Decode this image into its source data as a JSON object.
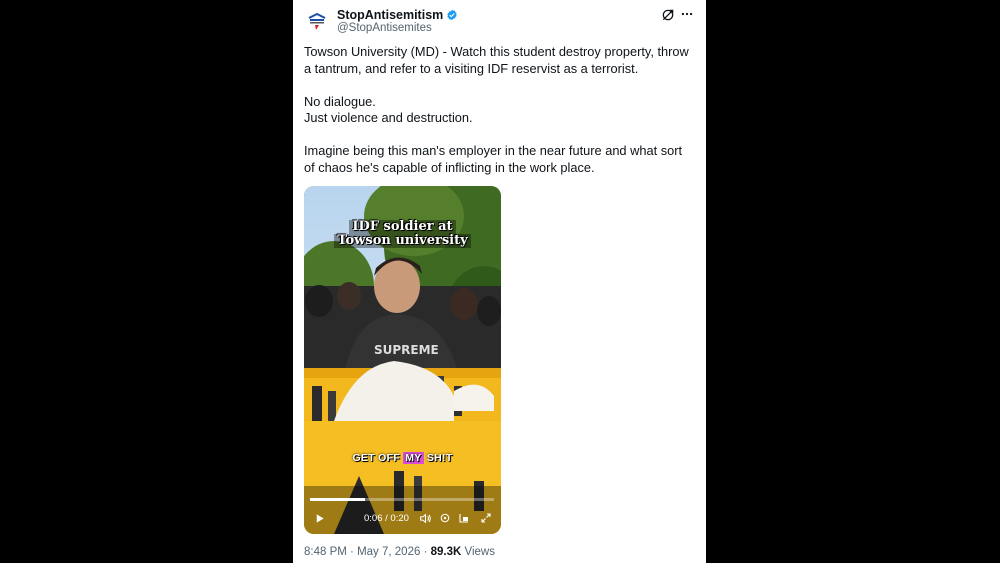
{
  "account": {
    "display_name": "StopAntisemitism",
    "handle": "@StopAntisemites",
    "verified": true
  },
  "tweet": {
    "paragraphs": [
      "Towson University (MD) - Watch this student destroy property, throw a tantrum, and refer to a visiting IDF reservist as a terrorist.",
      "No dialogue.",
      "Just violence and destruction.",
      "Imagine being this man's employer in the near future and what sort of chaos he's capable of inflicting in the work place."
    ]
  },
  "video": {
    "overlay_title_line1": "IDF soldier at",
    "overlay_title_line2": "Towson university",
    "caption_pre": "GET OFF ",
    "caption_highlight": "MY",
    "caption_post": " SH!T",
    "current_time": "0:06",
    "duration": "0:20",
    "time_separator": "/",
    "progress_fraction": 0.3
  },
  "meta": {
    "time": "8:48 PM",
    "date": "May 7, 2026",
    "separator": "·",
    "views_count": "89.3K",
    "views_label": "Views"
  },
  "icons": {
    "verified": "verified-badge-icon",
    "grok": "grok-icon",
    "more": "more-icon",
    "play": "play-icon",
    "volume": "volume-icon",
    "settings": "settings-icon",
    "pip": "picture-in-picture-icon",
    "fullscreen": "fullscreen-icon"
  },
  "colors": {
    "verified_blue": "#1d9bf0",
    "text_primary": "#0f1419",
    "text_secondary": "#536471",
    "caption_highlight": "#d94dd9"
  }
}
